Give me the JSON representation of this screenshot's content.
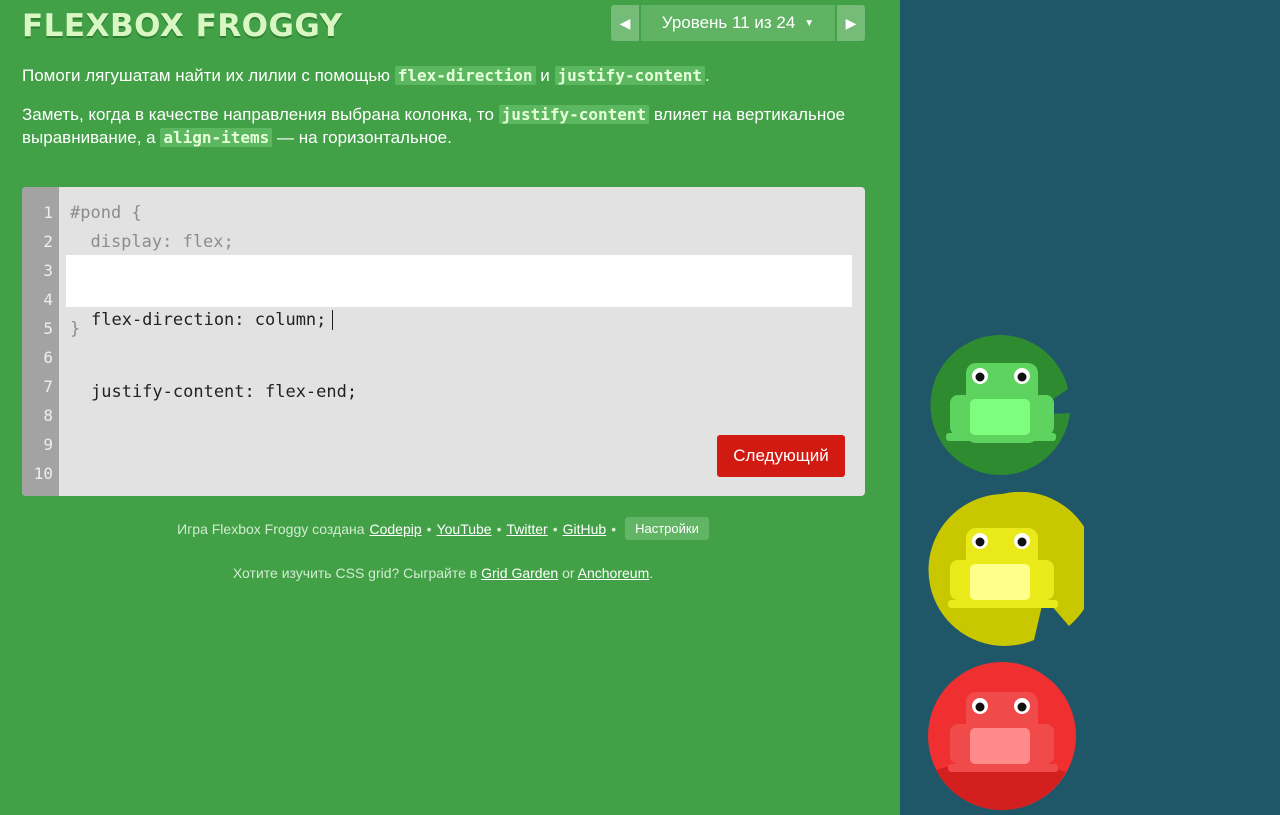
{
  "app": {
    "logo": "FLEXBOX FROGGY"
  },
  "level_nav": {
    "label": "Уровень 11 из 24",
    "prev_icon": "triangle-left-icon",
    "next_icon": "triangle-right-icon",
    "caret_icon": "caret-down-icon"
  },
  "instructions": {
    "p1_pre": "Помоги лягушатам найти их лилии с помощью ",
    "p1_code1": "flex-direction",
    "p1_mid": " и ",
    "p1_code2": "justify-content",
    "p1_post": ".",
    "p2_pre": "Заметь, когда в качестве направления выбрана колонка, то ",
    "p2_code1": "justify-content",
    "p2_mid": " влияет на вертикальное выравнивание, а ",
    "p2_code2": "align-items",
    "p2_post": " — на горизонтальное."
  },
  "editor": {
    "line_numbers": [
      "1",
      "2",
      "3",
      "4",
      "5",
      "6",
      "7",
      "8",
      "9",
      "10"
    ],
    "line1": "#pond {",
    "line2": "  display: flex;",
    "input_line1": "flex-direction: column;",
    "input_line2": "justify-content: flex-end;",
    "line5": "}",
    "next_button": "Следующий"
  },
  "credits": {
    "prefix": "Игра Flexbox Froggy создана",
    "codepip": "Codepip",
    "youtube": "YouTube",
    "twitter": "Twitter",
    "github": "GitHub",
    "separator": "•",
    "settings": "Настройки"
  },
  "grid_promo": {
    "prefix": "Хотите изучить CSS grid? Сыграйте в",
    "grid_garden": "Grid Garden",
    "or": "or",
    "anchoreum": "Anchoreum",
    "suffix": "."
  },
  "pond": {
    "frogs": [
      {
        "color": "green",
        "pad": "#2e8b30",
        "body": "#5fd35f",
        "belly": "#7dff7d"
      },
      {
        "color": "yellow",
        "pad": "#c9c700",
        "body": "#eaea1a",
        "belly": "#ffff8a"
      },
      {
        "color": "red",
        "pad": "#d41f1f",
        "body": "#f04a4a",
        "belly": "#ff8a8a"
      }
    ]
  },
  "colors": {
    "background": "#42a047",
    "pond": "#1f5768",
    "next_button": "#d01a12"
  }
}
